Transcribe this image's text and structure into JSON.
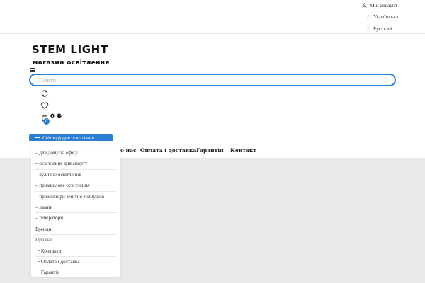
{
  "topbar": {
    "account_label": "Мій аккаунт",
    "languages": [
      "Українська",
      "Русский"
    ]
  },
  "logo": {
    "title": "STEM LIGHT",
    "subtitle": "магазин освітлення"
  },
  "search": {
    "placeholder": "Пошук"
  },
  "cart": {
    "count": "0",
    "total": "0 ₴"
  },
  "catalog_button": {
    "label": "Світлодіодне освітлення"
  },
  "nav": {
    "items": [
      "о нас",
      "Оплата і доставка",
      "Гарантія",
      "Контакт"
    ]
  },
  "dropdown": {
    "items": [
      "– для дому та офісу",
      "– освітлення для спорту",
      "– вуличне освітлення",
      "– промислове освітлення",
      "– прожектори зенітно-пошукові",
      "– лампи",
      "– генератори",
      "Бренди",
      "Про нас",
      "└ Контакти",
      "└ Оплата і доставка",
      "└ Гарантія"
    ]
  },
  "colors": {
    "accent": "#2a7fd0",
    "background_grey": "#e9e9e9"
  },
  "icons": [
    "user-icon",
    "menu-icon",
    "compare-icon",
    "heart-icon",
    "cart-icon"
  ]
}
